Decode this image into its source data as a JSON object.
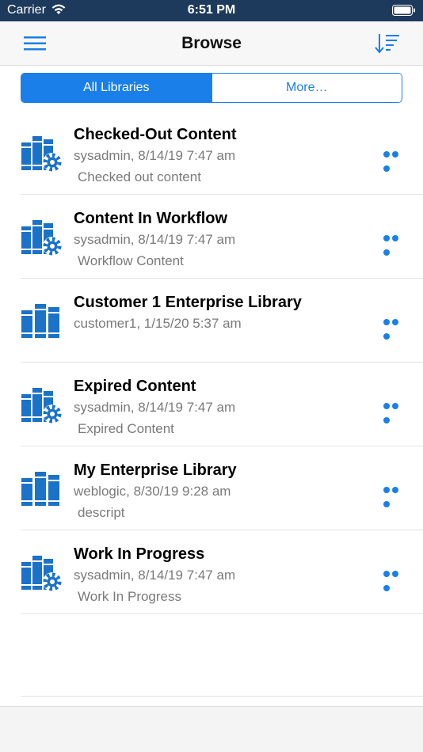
{
  "status_bar": {
    "carrier": "Carrier",
    "time": "6:51 PM"
  },
  "nav": {
    "title": "Browse"
  },
  "segments": {
    "all_libraries": "All Libraries",
    "more": "More…"
  },
  "colors": {
    "accent": "#1a7fe8",
    "status_bar_bg": "#1d3a5c",
    "secondary_text": "#7a7a7a"
  },
  "libraries": [
    {
      "name": "Checked-Out Content",
      "meta": "sysadmin, 8/14/19 7:47 am",
      "description": "Checked out content",
      "icon": "library-gear-icon"
    },
    {
      "name": "Content In Workflow",
      "meta": "sysadmin, 8/14/19 7:47 am",
      "description": "Workflow Content",
      "icon": "library-gear-icon"
    },
    {
      "name": "Customer 1 Enterprise Library",
      "meta": "customer1, 1/15/20 5:37 am",
      "description": "",
      "icon": "library-icon"
    },
    {
      "name": "Expired Content",
      "meta": "sysadmin, 8/14/19 7:47 am",
      "description": "Expired Content",
      "icon": "library-gear-icon"
    },
    {
      "name": "My Enterprise Library",
      "meta": "weblogic, 8/30/19 9:28 am",
      "description": "descript",
      "icon": "library-icon"
    },
    {
      "name": "Work In Progress",
      "meta": "sysadmin, 8/14/19 7:47 am",
      "description": "Work In Progress",
      "icon": "library-gear-icon"
    }
  ]
}
